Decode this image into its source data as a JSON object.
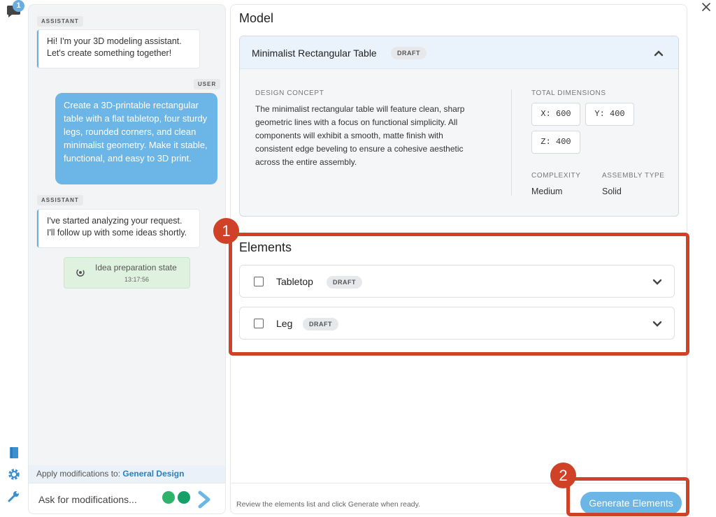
{
  "rail": {
    "chat_badge": "1"
  },
  "chat": {
    "messages": [
      {
        "role": "ASSISTANT",
        "text": "Hi! I'm your 3D modeling assistant. Let's create something together!"
      },
      {
        "role": "USER",
        "text": "Create a 3D-printable rectangular table with a flat tabletop, four sturdy legs, rounded corners, and clean minimalist geometry. Make it stable, functional, and easy to 3D print."
      },
      {
        "role": "ASSISTANT",
        "text": "I've started analyzing your request. I'll follow up with some ideas shortly."
      }
    ],
    "state": {
      "label": "Idea preparation state",
      "time": "13:17:56"
    },
    "apply_label": "Apply modifications to:",
    "apply_target": "General Design",
    "ask_placeholder": "Ask for modifications..."
  },
  "main": {
    "model_heading": "Model",
    "model": {
      "title": "Minimalist Rectangular Table",
      "status": "DRAFT",
      "design_concept_label": "DESIGN CONCEPT",
      "design_concept": "The minimalist rectangular table will feature clean, sharp geometric lines with a focus on functional simplicity. All components will exhibit a smooth, matte finish with consistent edge beveling to ensure a cohesive aesthetic across the entire assembly.",
      "dimensions_label": "TOTAL DIMENSIONS",
      "x": "X: 600",
      "y": "Y: 400",
      "z": "Z: 400",
      "complexity_label": "COMPLEXITY",
      "complexity": "Medium",
      "assembly_label": "ASSEMBLY TYPE",
      "assembly": "Solid"
    },
    "elements_heading": "Elements",
    "elements": [
      {
        "name": "Tabletop",
        "status": "DRAFT"
      },
      {
        "name": "Leg",
        "status": "DRAFT"
      }
    ],
    "footer_hint": "Review the elements list and click Generate when ready.",
    "generate_label": "Generate Elements"
  },
  "annotations": {
    "marker1": "1",
    "marker2": "2"
  },
  "colors": {
    "accent": "#6bb6e6",
    "annotation_red": "#cf4227",
    "state_green": "#dff2df"
  }
}
